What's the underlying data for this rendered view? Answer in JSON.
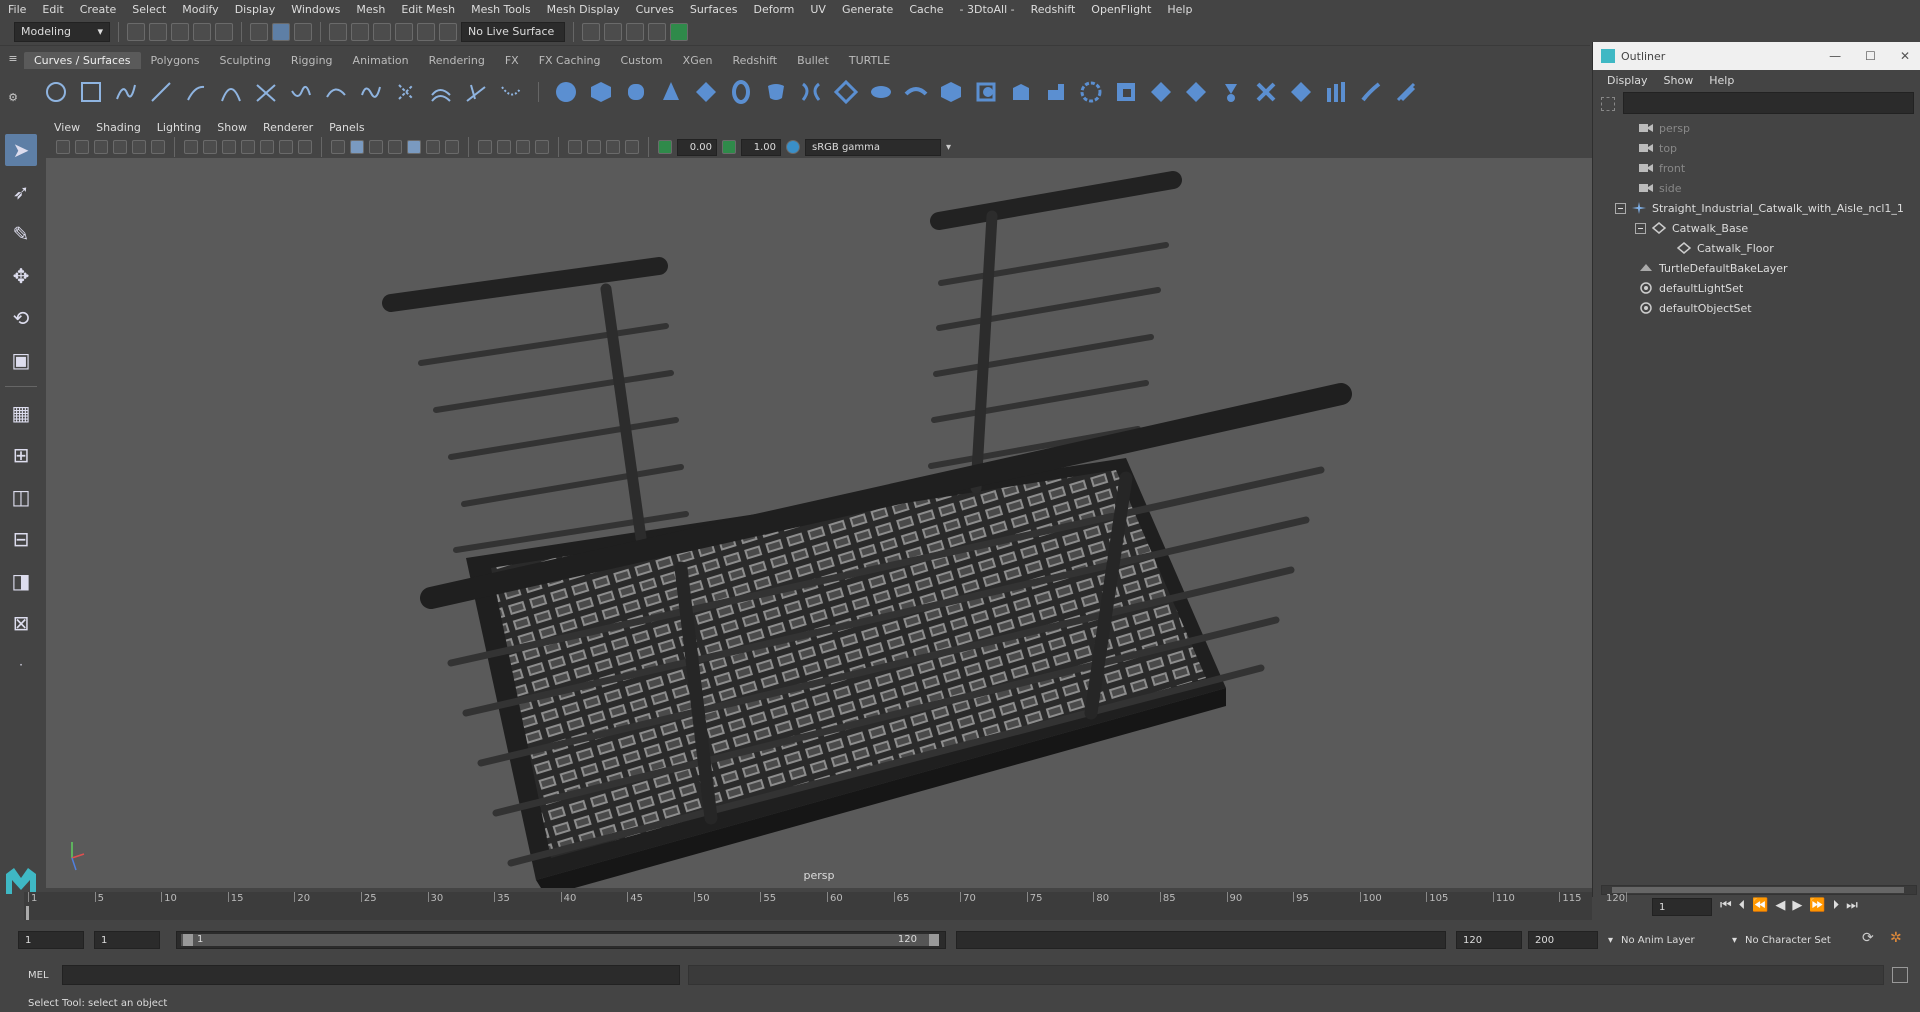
{
  "menubar": {
    "items": [
      "File",
      "Edit",
      "Create",
      "Select",
      "Modify",
      "Display",
      "Windows",
      "Mesh",
      "Edit Mesh",
      "Mesh Tools",
      "Mesh Display",
      "Curves",
      "Surfaces",
      "Deform",
      "UV",
      "Generate",
      "Cache",
      "- 3DtoAll -",
      "Redshift",
      "OpenFlight",
      "Help"
    ]
  },
  "status": {
    "mode": "Modeling",
    "live_surface": "No Live Surface"
  },
  "shelf_tabs": [
    "Curves / Surfaces",
    "Polygons",
    "Sculpting",
    "Rigging",
    "Animation",
    "Rendering",
    "FX",
    "FX Caching",
    "Custom",
    "XGen",
    "Redshift",
    "Bullet",
    "TURTLE"
  ],
  "viewport": {
    "menu": [
      "View",
      "Shading",
      "Lighting",
      "Show",
      "Renderer",
      "Panels"
    ],
    "exposure": "0.00",
    "gamma": "1.00",
    "colorspace": "sRGB gamma",
    "camera_label": "persp"
  },
  "outliner": {
    "title": "Outliner",
    "menu": [
      "Display",
      "Show",
      "Help"
    ],
    "items": [
      {
        "label": "persp",
        "icon": "camera-icon",
        "dim": true
      },
      {
        "label": "top",
        "icon": "camera-icon",
        "dim": true
      },
      {
        "label": "front",
        "icon": "camera-icon",
        "dim": true
      },
      {
        "label": "side",
        "icon": "camera-icon",
        "dim": true
      },
      {
        "label": "Straight_Industrial_Catwalk_with_Aisle_ncl1_1",
        "icon": "group-icon",
        "dim": false
      },
      {
        "label": "Catwalk_Base",
        "icon": "mesh-icon",
        "dim": false
      },
      {
        "label": "Catwalk_Floor",
        "icon": "mesh-icon",
        "dim": false
      },
      {
        "label": "TurtleDefaultBakeLayer",
        "icon": "bake-layer-icon",
        "dim": false
      },
      {
        "label": "defaultLightSet",
        "icon": "set-icon",
        "dim": false
      },
      {
        "label": "defaultObjectSet",
        "icon": "set-icon",
        "dim": false
      }
    ]
  },
  "timeline": {
    "ticks": [
      "1",
      "5",
      "10",
      "15",
      "20",
      "25",
      "30",
      "35",
      "40",
      "45",
      "50",
      "55",
      "60",
      "65",
      "70",
      "75",
      "80",
      "85",
      "90",
      "95",
      "100",
      "105",
      "110",
      "115",
      "120"
    ],
    "current_frame": "1"
  },
  "range": {
    "start": "1",
    "playback_start": "1",
    "slider_start": "1",
    "slider_end": "120",
    "playback_end": "120",
    "end": "200",
    "anim_layer": "No Anim Layer",
    "character_set": "No Character Set"
  },
  "cmd": {
    "label": "MEL"
  },
  "help": {
    "text": "Select Tool: select an object"
  },
  "colors": {
    "accent": "#5e7fa6",
    "viewport_bg": "#5a5a5a"
  }
}
